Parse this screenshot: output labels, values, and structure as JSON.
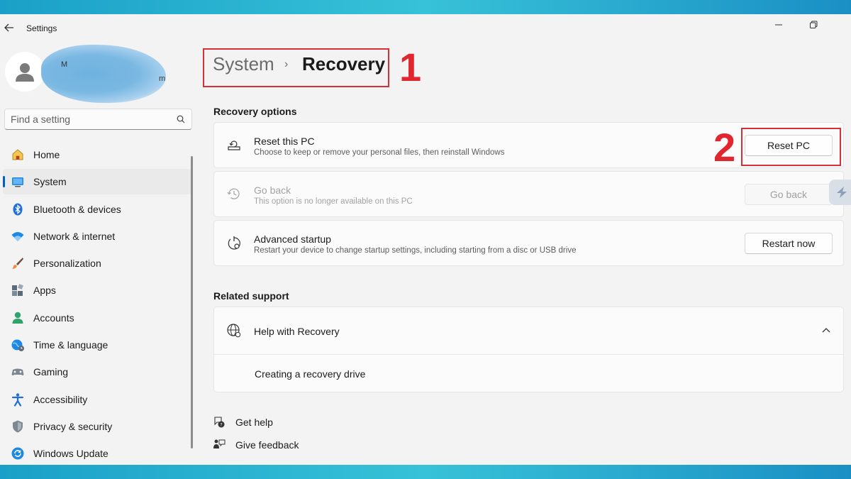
{
  "window": {
    "app_title": "Settings"
  },
  "user": {
    "name_fragment": "M",
    "email_fragment": "m"
  },
  "search": {
    "placeholder": "Find a setting"
  },
  "sidebar": {
    "items": [
      {
        "label": "Home",
        "icon": "home-icon"
      },
      {
        "label": "System",
        "icon": "system-icon",
        "selected": true
      },
      {
        "label": "Bluetooth & devices",
        "icon": "bluetooth-icon"
      },
      {
        "label": "Network & internet",
        "icon": "wifi-icon"
      },
      {
        "label": "Personalization",
        "icon": "brush-icon"
      },
      {
        "label": "Apps",
        "icon": "apps-icon"
      },
      {
        "label": "Accounts",
        "icon": "accounts-icon"
      },
      {
        "label": "Time & language",
        "icon": "time-language-icon"
      },
      {
        "label": "Gaming",
        "icon": "gaming-icon"
      },
      {
        "label": "Accessibility",
        "icon": "accessibility-icon"
      },
      {
        "label": "Privacy & security",
        "icon": "shield-icon"
      },
      {
        "label": "Windows Update",
        "icon": "update-icon"
      }
    ]
  },
  "breadcrumb": {
    "parent": "System",
    "separator": "›",
    "current": "Recovery"
  },
  "annotations": {
    "step1": "1",
    "step2": "2",
    "color": "#e0262f"
  },
  "recovery_options": {
    "heading": "Recovery options",
    "reset": {
      "title": "Reset this PC",
      "subtitle": "Choose to keep or remove your personal files, then reinstall Windows",
      "button": "Reset PC"
    },
    "go_back": {
      "title": "Go back",
      "subtitle": "This option is no longer available on this PC",
      "button": "Go back"
    },
    "advanced": {
      "title": "Advanced startup",
      "subtitle": "Restart your device to change startup settings, including starting from a disc or USB drive",
      "button": "Restart now"
    }
  },
  "related_support": {
    "heading": "Related support",
    "help_title": "Help with Recovery",
    "link": "Creating a recovery drive"
  },
  "footer_links": {
    "get_help": "Get help",
    "give_feedback": "Give feedback"
  },
  "colors": {
    "accent": "#005fb8",
    "highlight_box": "#d5303a"
  }
}
